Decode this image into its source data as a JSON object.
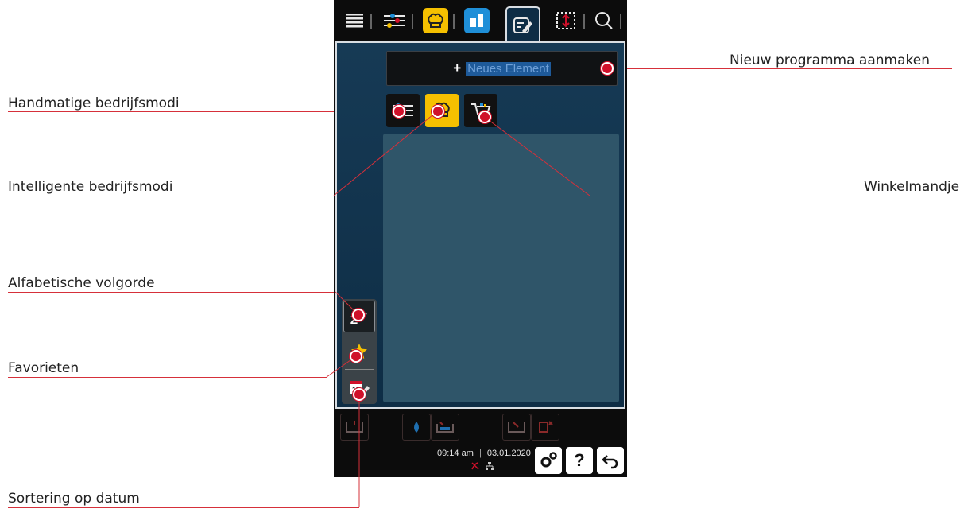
{
  "callouts": {
    "new_program": "Nieuw programma aanmaken",
    "manual_modes": "Handmatige bedrijfsmodi",
    "intelligent_modes": "Intelligente bedrijfsmodi",
    "shopping_cart": "Winkelmandje",
    "alphabetical": "Alfabetische volgorde",
    "favorites": "Favorieten",
    "sort_date": "Sortering op datum"
  },
  "device": {
    "top_tabs": [
      "list-icon",
      "sliders-icon",
      "chef-hat-icon",
      "dashboard-icon",
      "edit-icon",
      "transfer-icon",
      "search-icon"
    ],
    "active_tab": "edit-icon",
    "new_element": {
      "plus": "+",
      "label": "Neues Element"
    },
    "filters": [
      "manual-modes-icon",
      "intelligent-modes-icon",
      "shopping-cart-icon"
    ],
    "sort_buttons": {
      "alpha_label": "Z",
      "calendar_day": "17"
    },
    "status": {
      "time": "09:14 am",
      "date": "03.01.2020"
    },
    "bottom_buttons": {
      "help": "?"
    },
    "colors": {
      "accent_yellow": "#f5c000",
      "accent_blue": "#1f8fd8",
      "callout_red": "#d0102a",
      "panel_blue": "#163a55"
    }
  }
}
